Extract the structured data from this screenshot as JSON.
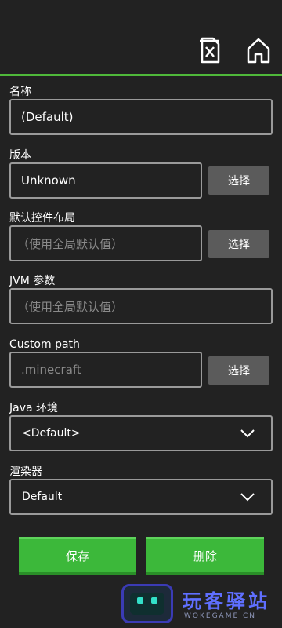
{
  "header": {
    "delete_icon": "delete-file-icon",
    "home_icon": "home-icon",
    "accent_color": "#4fb83a"
  },
  "form": {
    "name": {
      "label": "名称",
      "value": "(Default)"
    },
    "version": {
      "label": "版本",
      "value": "Unknown",
      "button": "选择"
    },
    "control_layout": {
      "label": "默认控件布局",
      "placeholder": "（使用全局默认值）",
      "button": "选择"
    },
    "jvm_args": {
      "label": "JVM 参数",
      "placeholder": "（使用全局默认值）"
    },
    "custom_path": {
      "label": "Custom path",
      "placeholder": ".minecraft",
      "button": "选择"
    },
    "java_env": {
      "label": "Java 环境",
      "selected": "<Default>"
    },
    "renderer": {
      "label": "渲染器",
      "selected": "Default"
    }
  },
  "actions": {
    "save": "保存",
    "delete": "删除",
    "button_color": "#3cb83a"
  },
  "watermark": {
    "title": "玩客驿站",
    "subtitle": "WOKEGAME.CN"
  }
}
